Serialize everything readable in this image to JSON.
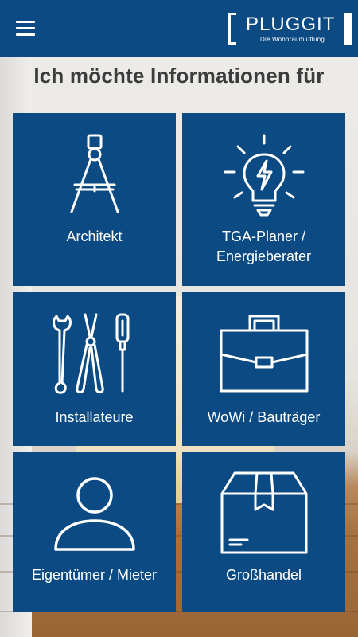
{
  "appbar": {
    "logo_text": "PLUGGIT",
    "logo_tagline": "Die Wohnraumlüftung."
  },
  "heading": "Ich möchte Informationen für",
  "tiles": [
    {
      "label": "Architekt",
      "icon": "compass-icon"
    },
    {
      "label": "TGA-Planer / Energieberater",
      "label_lines": [
        "TGA-Planer /",
        "Energieberater"
      ],
      "icon": "lightbulb-icon"
    },
    {
      "label": "Installateure",
      "icon": "tools-icon"
    },
    {
      "label": "WoWi / Bauträger",
      "icon": "briefcase-icon"
    },
    {
      "label": "Eigentümer / Mieter",
      "icon": "person-icon"
    },
    {
      "label": "Großhandel",
      "icon": "box-icon"
    }
  ],
  "colors": {
    "primary": "#0b4a82",
    "tile_text": "#ffffff",
    "heading": "#3c3c3c"
  }
}
